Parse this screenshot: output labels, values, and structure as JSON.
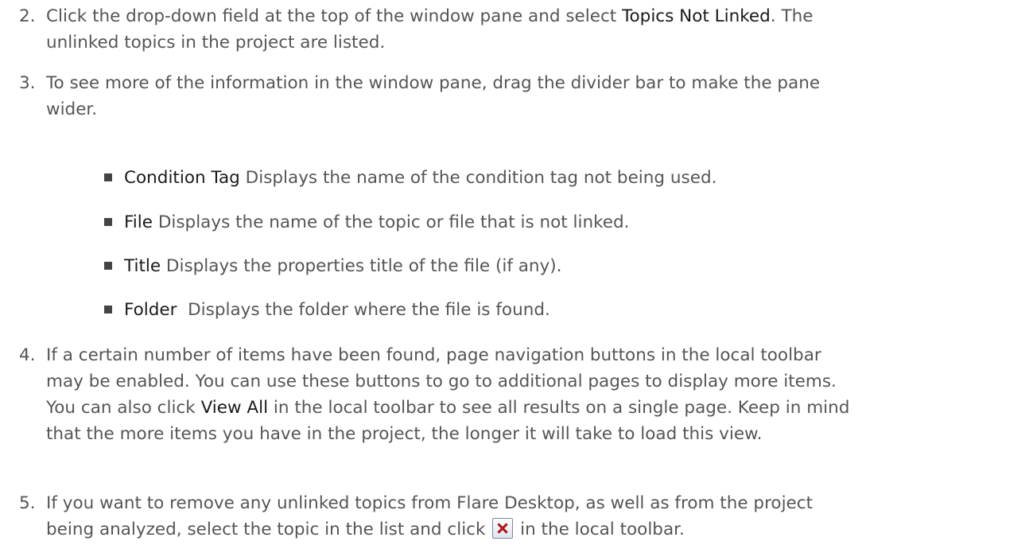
{
  "steps": [
    {
      "number": "2.",
      "lines": [
        {
          "before": "Click the drop-down field at the top of the window pane and select ",
          "ui": "Topics Not Linked",
          "after": ". The"
        },
        {
          "text": "unlinked topics in the project are listed."
        }
      ]
    },
    {
      "number": "3.",
      "lines": [
        {
          "text": "To see more of the information in the window pane, drag the divider bar to make the pane"
        },
        {
          "text": "wider."
        }
      ],
      "bullets": [
        {
          "term": "Condition Tag",
          "desc": " Displays the name of the condition tag not being used."
        },
        {
          "term": "File",
          "desc": " Displays the name of the topic or file that is not linked."
        },
        {
          "term": "Title",
          "desc": " Displays the properties title of the file (if any)."
        },
        {
          "term": "Folder",
          "desc": "  Displays the folder where the file is found."
        }
      ]
    },
    {
      "number": "4.",
      "lines": [
        {
          "text": "If a certain number of items have been found, page navigation buttons in the local toolbar"
        },
        {
          "text": "may be enabled. You can use these buttons to go to additional pages to display more items."
        },
        {
          "before": "You can also click ",
          "ui": "View All",
          "after": " in the local toolbar to see all results on a single page. Keep in mind"
        },
        {
          "text": "that the more items you have in the project, the longer it will take to load this view."
        }
      ]
    },
    {
      "number": "5.",
      "lines": [
        {
          "text": "If you want to remove any unlinked topics from Flare Desktop, as well as from the project"
        },
        {
          "before": "being analyzed, select the topic in the list and click ",
          "icon": "delete-icon",
          "after": " in the local toolbar."
        }
      ]
    }
  ]
}
